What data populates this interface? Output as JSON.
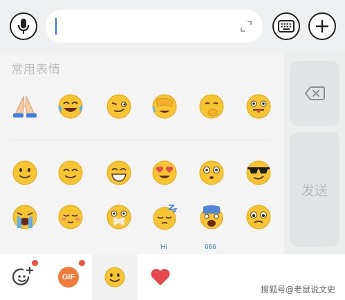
{
  "input_bar": {
    "placeholder": "",
    "value": "",
    "caret_color": "#2f6df6"
  },
  "icons": {
    "voice": "microphone-icon",
    "expand": "expand-icon",
    "keyboard": "keyboard-icon",
    "more": "plus-icon",
    "backspace": "backspace-icon",
    "add_sticker": "add-sticker-icon",
    "favorites": "heart-icon"
  },
  "emoji_panel": {
    "section_title": "常用表情",
    "frequent": [
      "folded-hands",
      "face-with-tears-of-joy",
      "smirk-face",
      "facepalm-face",
      "thinking-covering-mouth-face",
      "tongue-out-face"
    ],
    "all_row1": [
      "slightly-smiling-face",
      "smiling-face",
      "grinning-face",
      "heart-eyes-face",
      "flushed-face",
      "sunglasses-face"
    ],
    "all_row2": [
      "loudly-crying-face",
      "shy-blushing-face",
      "mouth-taped-face",
      "sleepy-zzz-face",
      "anguished-face",
      "pleading-face"
    ],
    "partial_row_marks": [
      "",
      "",
      "",
      "Hi",
      "666",
      ""
    ]
  },
  "side_keys": {
    "send_label": "发送"
  },
  "tabs": [
    {
      "id": "add",
      "label": "",
      "has_dot": true
    },
    {
      "id": "gif",
      "label": "GIF",
      "has_dot": true
    },
    {
      "id": "emoji",
      "label": "",
      "active": true
    },
    {
      "id": "favorites",
      "label": ""
    }
  ],
  "watermark": "搜狐号@老鼠说文史",
  "colors": {
    "emoji_yellow": "#f7c531",
    "heart_red": "#e5484d",
    "gif_orange": "#f07b3b",
    "badge_dot": "#f0513c"
  }
}
